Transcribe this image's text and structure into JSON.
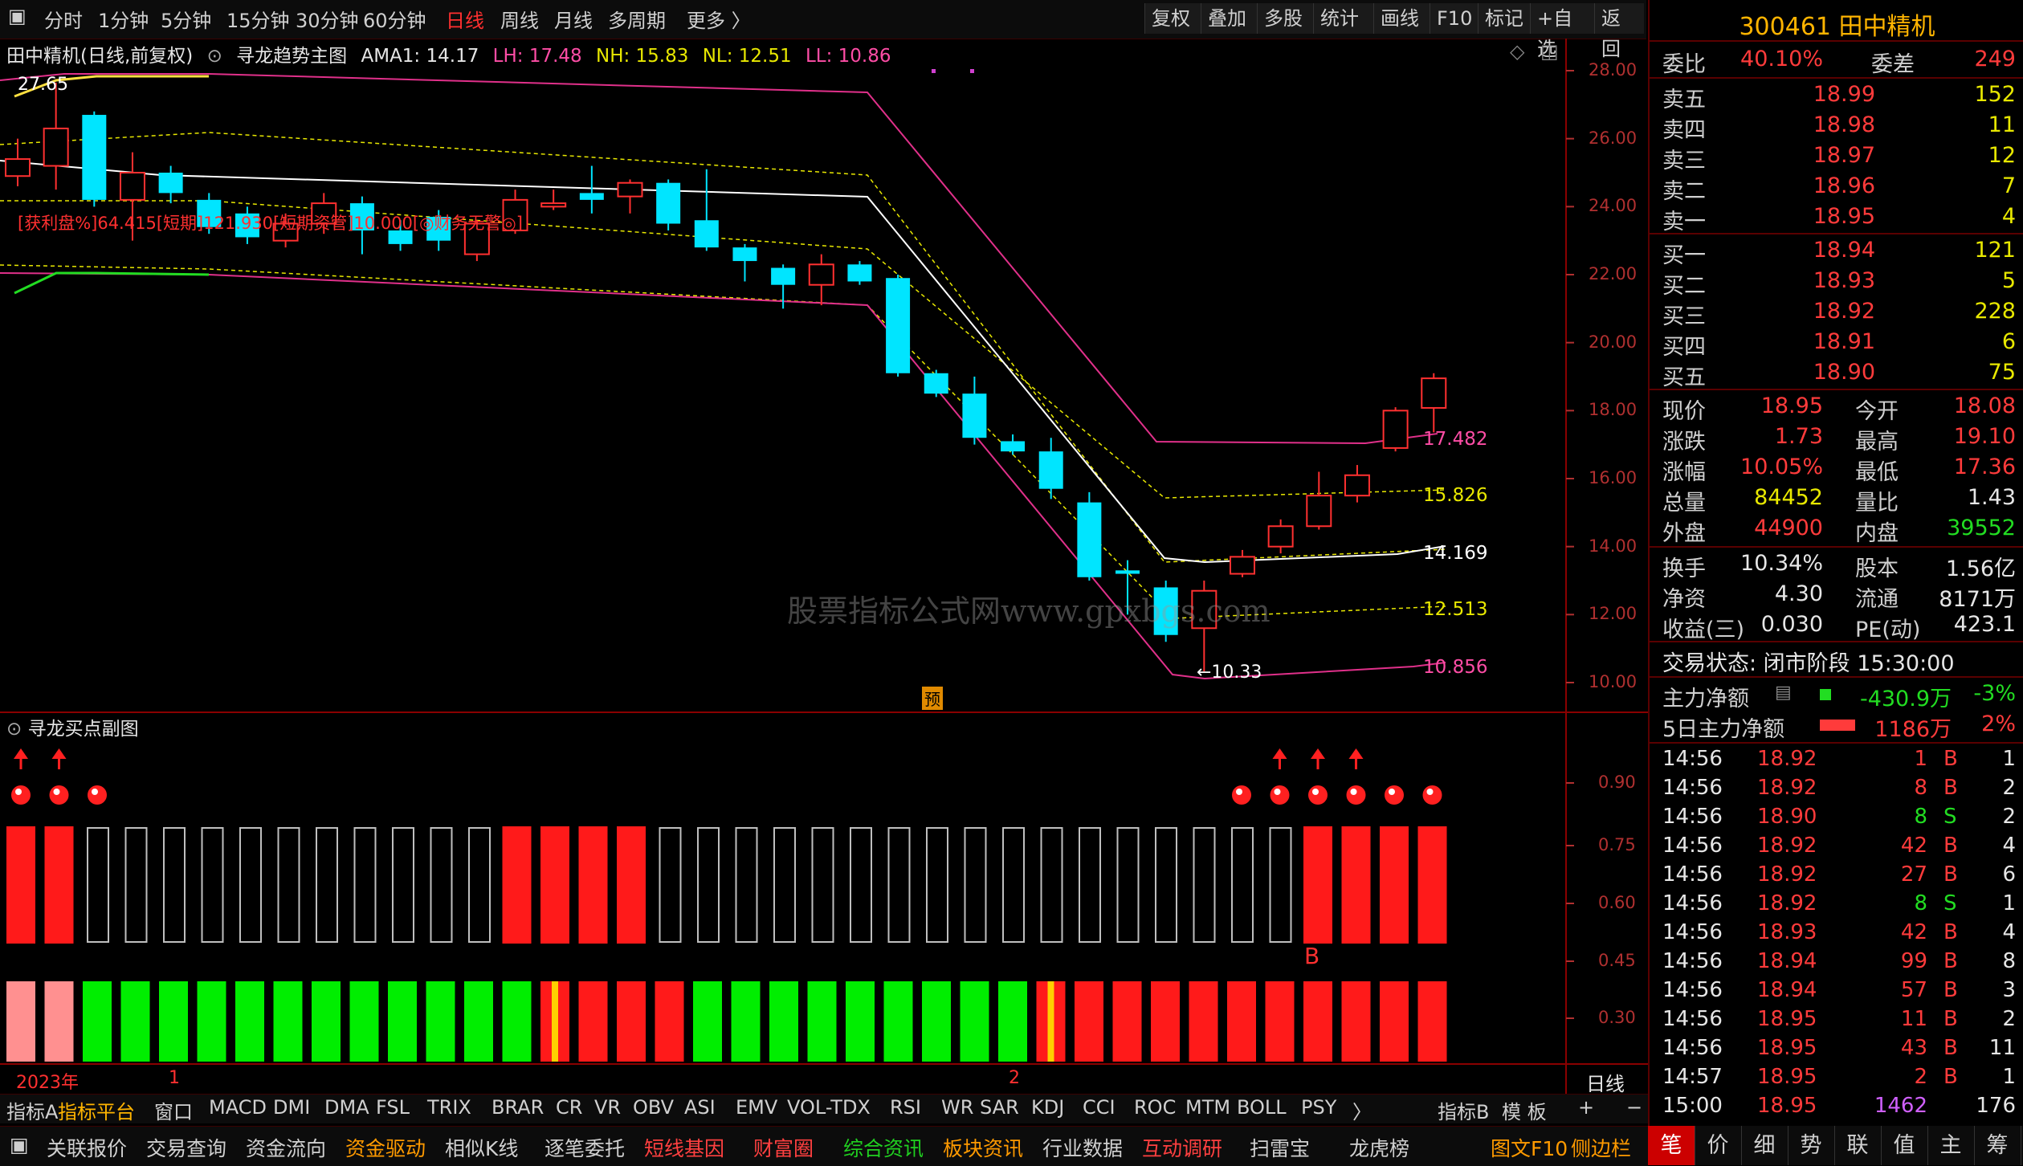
{
  "toolbar": {
    "periods": [
      "分时",
      "1分钟",
      "5分钟",
      "15分钟",
      "30分钟",
      "60分钟",
      "日线",
      "周线",
      "月线",
      "多周期",
      "更多 〉"
    ],
    "active_period": "日线",
    "buttons": [
      "复权",
      "叠加",
      "多股",
      "统计",
      "画线",
      "F10",
      "标记",
      "+自选",
      "返回"
    ]
  },
  "main_chart": {
    "title": "田中精机(日线,前复权)",
    "indicator": "寻龙趋势主图",
    "ama1": "AMA1: 14.17",
    "lh": "LH: 17.48",
    "nh": "NH: 15.83",
    "nl": "NL: 12.51",
    "ll": "LL: 10.86",
    "annotation": "[获利盘%]64.415[短期]121.930[短期资管]10.000[◎财务无警◎]",
    "high_label": "27.65",
    "low_label": "←10.33",
    "pre_label": "预",
    "y_ticks": [
      "28.00",
      "26.00",
      "24.00",
      "22.00",
      "20.00",
      "18.00",
      "16.00",
      "14.00",
      "12.00",
      "10.00"
    ],
    "line_labels": [
      "17.482",
      "15.826",
      "14.169",
      "12.513",
      "10.856"
    ]
  },
  "sub_chart": {
    "title": "寻龙买点副图",
    "y_ticks": [
      "0.90",
      "0.75",
      "0.60",
      "0.45",
      "0.30"
    ],
    "b_label": "B"
  },
  "x_axis": {
    "year": "2023年",
    "marks": [
      "1",
      "2"
    ],
    "period_label": "日线"
  },
  "watermark": "股票指标公式网www.gpxbgs.com",
  "chart_data": {
    "type": "candlestick",
    "title": "寻龙趋势主图",
    "ylim": [
      9.5,
      28.5
    ],
    "candles": [
      {
        "o": 24.9,
        "c": 25.4,
        "h": 26.0,
        "l": 24.6
      },
      {
        "o": 25.2,
        "c": 26.3,
        "h": 27.65,
        "l": 24.5
      },
      {
        "o": 26.7,
        "c": 24.2,
        "h": 26.8,
        "l": 24.0
      },
      {
        "o": 24.2,
        "c": 25.0,
        "h": 25.6,
        "l": 23.0
      },
      {
        "o": 25.0,
        "c": 24.4,
        "h": 25.2,
        "l": 24.1
      },
      {
        "o": 24.2,
        "c": 23.4,
        "h": 24.4,
        "l": 23.2
      },
      {
        "o": 23.8,
        "c": 23.1,
        "h": 24.0,
        "l": 22.9
      },
      {
        "o": 23.0,
        "c": 23.5,
        "h": 23.8,
        "l": 22.8
      },
      {
        "o": 23.5,
        "c": 24.1,
        "h": 24.4,
        "l": 23.2
      },
      {
        "o": 24.1,
        "c": 23.3,
        "h": 24.3,
        "l": 22.6
      },
      {
        "o": 23.3,
        "c": 22.9,
        "h": 23.6,
        "l": 22.7
      },
      {
        "o": 23.7,
        "c": 23.0,
        "h": 23.9,
        "l": 22.7
      },
      {
        "o": 22.6,
        "c": 23.5,
        "h": 23.6,
        "l": 22.4
      },
      {
        "o": 23.3,
        "c": 24.2,
        "h": 24.5,
        "l": 23.2
      },
      {
        "o": 24.0,
        "c": 24.1,
        "h": 24.5,
        "l": 23.9
      },
      {
        "o": 24.4,
        "c": 24.2,
        "h": 25.2,
        "l": 23.8
      },
      {
        "o": 24.3,
        "c": 24.7,
        "h": 24.8,
        "l": 23.8
      },
      {
        "o": 24.7,
        "c": 23.5,
        "h": 24.8,
        "l": 23.3
      },
      {
        "o": 23.6,
        "c": 22.8,
        "h": 25.1,
        "l": 22.7
      },
      {
        "o": 22.8,
        "c": 22.4,
        "h": 22.9,
        "l": 21.8
      },
      {
        "o": 22.2,
        "c": 21.7,
        "h": 22.3,
        "l": 21.0
      },
      {
        "o": 21.7,
        "c": 22.3,
        "h": 22.6,
        "l": 21.1
      },
      {
        "o": 22.3,
        "c": 21.8,
        "h": 22.4,
        "l": 21.7
      },
      {
        "o": 21.9,
        "c": 19.1,
        "h": 22.0,
        "l": 19.0
      },
      {
        "o": 19.1,
        "c": 18.5,
        "h": 19.2,
        "l": 18.4
      },
      {
        "o": 18.5,
        "c": 17.2,
        "h": 19.0,
        "l": 17.0
      },
      {
        "o": 17.1,
        "c": 16.8,
        "h": 17.3,
        "l": 16.7
      },
      {
        "o": 16.8,
        "c": 15.7,
        "h": 17.2,
        "l": 15.4
      },
      {
        "o": 15.3,
        "c": 13.1,
        "h": 15.6,
        "l": 13.0
      },
      {
        "o": 13.3,
        "c": 13.2,
        "h": 13.6,
        "l": 12.0
      },
      {
        "o": 12.8,
        "c": 11.4,
        "h": 13.0,
        "l": 11.2
      },
      {
        "o": 11.6,
        "c": 12.7,
        "h": 13.0,
        "l": 10.33
      },
      {
        "o": 13.2,
        "c": 13.7,
        "h": 13.9,
        "l": 13.1
      },
      {
        "o": 14.0,
        "c": 14.6,
        "h": 14.8,
        "l": 13.8
      },
      {
        "o": 14.6,
        "c": 15.5,
        "h": 16.2,
        "l": 14.5
      },
      {
        "o": 15.5,
        "c": 16.1,
        "h": 16.4,
        "l": 15.3
      },
      {
        "o": 16.9,
        "c": 18.0,
        "h": 18.1,
        "l": 16.8
      },
      {
        "o": 18.08,
        "c": 18.95,
        "h": 19.1,
        "l": 17.36
      }
    ]
  },
  "quote": {
    "code_name": "300461 田中精机",
    "weibi_label": "委比",
    "weibi": "40.10%",
    "weicha_label": "委差",
    "weicha": "249",
    "asks": [
      {
        "label": "卖五",
        "price": "18.99",
        "vol": "152"
      },
      {
        "label": "卖四",
        "price": "18.98",
        "vol": "11"
      },
      {
        "label": "卖三",
        "price": "18.97",
        "vol": "12"
      },
      {
        "label": "卖二",
        "price": "18.96",
        "vol": "7"
      },
      {
        "label": "卖一",
        "price": "18.95",
        "vol": "4"
      }
    ],
    "bids": [
      {
        "label": "买一",
        "price": "18.94",
        "vol": "121"
      },
      {
        "label": "买二",
        "price": "18.93",
        "vol": "5"
      },
      {
        "label": "买三",
        "price": "18.92",
        "vol": "228"
      },
      {
        "label": "买四",
        "price": "18.91",
        "vol": "6"
      },
      {
        "label": "买五",
        "price": "18.90",
        "vol": "75"
      }
    ],
    "stats": [
      {
        "k": "现价",
        "v": "18.95",
        "k2": "今开",
        "v2": "18.08"
      },
      {
        "k": "涨跌",
        "v": "1.73",
        "k2": "最高",
        "v2": "19.10"
      },
      {
        "k": "涨幅",
        "v": "10.05%",
        "k2": "最低",
        "v2": "17.36"
      },
      {
        "k": "总量",
        "v": "84452",
        "k2": "量比",
        "v2": "1.43"
      },
      {
        "k": "外盘",
        "v": "44900",
        "k2": "内盘",
        "v2": "39552"
      }
    ],
    "fin": [
      {
        "k": "换手",
        "v": "10.34%",
        "k2": "股本",
        "v2": "1.56亿"
      },
      {
        "k": "净资",
        "v": "4.30",
        "k2": "流通",
        "v2": "8171万"
      },
      {
        "k": "收益(三)",
        "v": "0.030",
        "k2": "PE(动)",
        "v2": "423.1"
      }
    ],
    "trade_status": "交易状态: 闭市阶段 15:30:00",
    "main_net_label": "主力净额",
    "main_net": "-430.9万",
    "main_net_pct": "-3%",
    "main5_label": "5日主力净额",
    "main5": "1186万",
    "main5_pct": "2%",
    "ticks": [
      {
        "t": "14:56",
        "p": "18.92",
        "v": "1",
        "s": "B",
        "n": "1"
      },
      {
        "t": "14:56",
        "p": "18.92",
        "v": "8",
        "s": "B",
        "n": "2"
      },
      {
        "t": "14:56",
        "p": "18.90",
        "v": "8",
        "s": "S",
        "n": "2"
      },
      {
        "t": "14:56",
        "p": "18.92",
        "v": "42",
        "s": "B",
        "n": "4"
      },
      {
        "t": "14:56",
        "p": "18.92",
        "v": "27",
        "s": "B",
        "n": "6"
      },
      {
        "t": "14:56",
        "p": "18.92",
        "v": "8",
        "s": "S",
        "n": "1"
      },
      {
        "t": "14:56",
        "p": "18.93",
        "v": "42",
        "s": "B",
        "n": "4"
      },
      {
        "t": "14:56",
        "p": "18.94",
        "v": "99",
        "s": "B",
        "n": "8"
      },
      {
        "t": "14:56",
        "p": "18.94",
        "v": "57",
        "s": "B",
        "n": "3"
      },
      {
        "t": "14:56",
        "p": "18.95",
        "v": "11",
        "s": "B",
        "n": "2"
      },
      {
        "t": "14:56",
        "p": "18.95",
        "v": "43",
        "s": "B",
        "n": "11"
      },
      {
        "t": "14:57",
        "p": "18.95",
        "v": "2",
        "s": "B",
        "n": "1"
      },
      {
        "t": "15:00",
        "p": "18.95",
        "v": "1462",
        "s": "",
        "n": "176"
      }
    ]
  },
  "indicator_tabs": [
    "指标A",
    "指标平台",
    "窗口",
    "MACD",
    "DMI",
    "DMA",
    "FSL",
    "TRIX",
    "BRAR",
    "CR",
    "VR",
    "OBV",
    "ASI",
    "EMV",
    "VOL-TDX",
    "RSI",
    "WR",
    "SAR",
    "KDJ",
    "CCI",
    "ROC",
    "MTM",
    "BOLL",
    "PSY",
    "〉"
  ],
  "indicator_right": [
    "指标B",
    "模 板",
    "+",
    "−"
  ],
  "bottom_bar": [
    "关联报价",
    "交易查询",
    "资金流向",
    "资金驱动",
    "相似K线",
    "逐笔委托",
    "短线基因",
    "财富圈",
    "综合资讯",
    "板块资讯",
    "行业数据",
    "互动调研",
    "扫雷宝",
    "龙虎榜",
    "图文F10",
    "侧边栏"
  ],
  "right_tabs": [
    "笔",
    "价",
    "细",
    "势",
    "联",
    "值",
    "主",
    "筹"
  ],
  "colors": {
    "up": "#ff3030",
    "down": "#00e5ff",
    "bg": "#000000",
    "accent": "#ff3030",
    "green": "#22dd22"
  }
}
